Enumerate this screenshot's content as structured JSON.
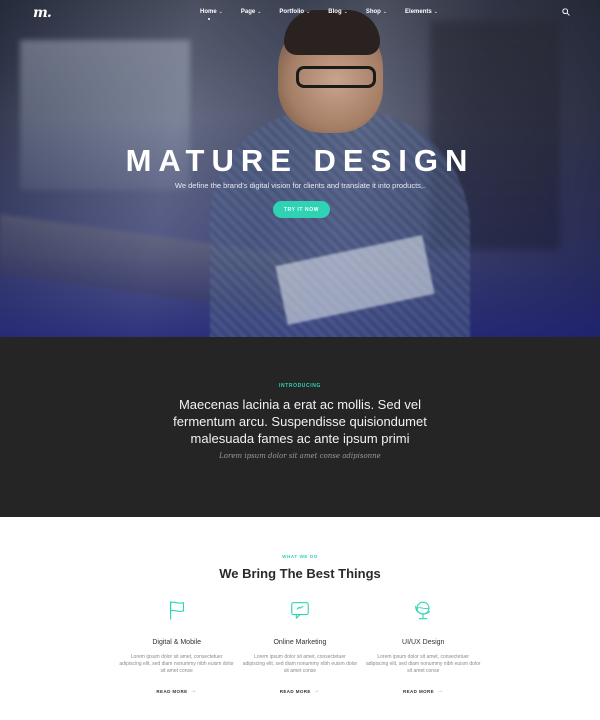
{
  "nav": {
    "logo": "m.",
    "items": [
      {
        "label": "Home",
        "active": true
      },
      {
        "label": "Page"
      },
      {
        "label": "Portfolio"
      },
      {
        "label": "Blog"
      },
      {
        "label": "Shop"
      },
      {
        "label": "Elements"
      }
    ],
    "caret": "⌄",
    "search_icon": "search-icon"
  },
  "hero": {
    "title": "MATURE DESIGN",
    "subtitle": "We define the brand's digital vision for clients and translate it into products,.",
    "button": "TRY IT NOW"
  },
  "intro": {
    "kicker": "INTRODUCING",
    "text": "Maecenas lacinia a erat ac mollis. Sed vel fermentum arcu. Suspendisse quisiondumet malesuada fames ac ante ipsum primi",
    "quote": "Lorem ipsum dolor sit amet conse adipisonne"
  },
  "services": {
    "kicker": "WHAT WE DO",
    "title": "We Bring The Best Things",
    "items": [
      {
        "icon": "flag-icon",
        "title": "Digital & Mobile",
        "text": "Lorem ipsum dolor sit amet, consectetuer adipiscing elit, sed diam nonummy nibh euism dolor sit amet conse",
        "link": "READ MORE"
      },
      {
        "icon": "chat-bubble-icon",
        "title": "Online Marketing",
        "text": "Lorem ipsum dolor sit amet, consectetuer adipiscing elit, sed diam nonummy nibh euism dolor sit amet conse",
        "link": "READ MORE"
      },
      {
        "icon": "globe-icon",
        "title": "UI/UX Design",
        "text": "Lorem ipsum dolor sit amet, consectetuer adipiscing elit, sed diam nonummy nibh euism dolor sit amet conse",
        "link": "READ MORE"
      }
    ],
    "arrow": "→"
  },
  "colors": {
    "accent": "#2ed3b4",
    "dark_section": "#252525",
    "hero_overlay": "#24286e"
  }
}
